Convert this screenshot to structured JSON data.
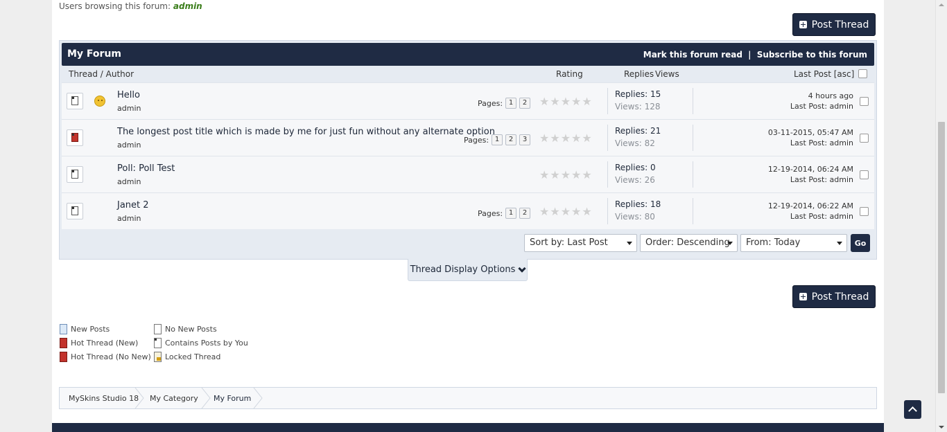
{
  "header": {
    "browsing_label": "Users browsing this forum:",
    "browsing_user": "admin"
  },
  "post_thread_label": "Post Thread",
  "forum": {
    "title": "My Forum",
    "mark_read": "Mark this forum read",
    "separator": "|",
    "subscribe": "Subscribe to this forum"
  },
  "columns": {
    "thread_author": "Thread / Author",
    "rating": "Rating",
    "replies": "Replies",
    "views": "Views",
    "last_post": "Last Post [asc]"
  },
  "threads": [
    {
      "title": "Hello",
      "author": "admin",
      "hot": false,
      "smiley": true,
      "pages_label": "Pages:",
      "pages": [
        "1",
        "2"
      ],
      "replies": "Replies: 15",
      "views": "Views: 128",
      "last_date": "4 hours ago",
      "last_by": "Last Post: admin"
    },
    {
      "title": "The longest post title which is made by me for just fun without any alternate option",
      "author": "admin",
      "hot": true,
      "smiley": false,
      "pages_label": "Pages:",
      "pages": [
        "1",
        "2",
        "3"
      ],
      "replies": "Replies: 21",
      "views": "Views: 82",
      "last_date": "03-11-2015, 05:47 AM",
      "last_by": "Last Post: admin"
    },
    {
      "title": "Poll: Poll Test",
      "author": "admin",
      "hot": false,
      "smiley": false,
      "pages_label": "",
      "pages": [],
      "replies": "Replies: 0",
      "views": "Views: 26",
      "last_date": "12-19-2014, 06:24 AM",
      "last_by": "Last Post: admin"
    },
    {
      "title": "Janet 2",
      "author": "admin",
      "hot": false,
      "smiley": false,
      "pages_label": "Pages:",
      "pages": [
        "1",
        "2"
      ],
      "replies": "Replies: 18",
      "views": "Views: 80",
      "last_date": "12-19-2014, 06:22 AM",
      "last_by": "Last Post: admin"
    }
  ],
  "sort": {
    "sort_by": "Sort by: Last Post",
    "order": "Order: Descending",
    "from": "From: Today",
    "go": "Go"
  },
  "display_options": "Thread Display Options",
  "legend": {
    "new_posts": "New Posts",
    "no_new_posts": "No New Posts",
    "hot_new": "Hot Thread (New)",
    "contains_yours": "Contains Posts by You",
    "hot_no_new": "Hot Thread (No New)",
    "locked": "Locked Thread"
  },
  "breadcrumb": [
    "MySkins Studio 18",
    "My Category",
    "My Forum"
  ],
  "colors": {
    "header_navy": "#1f2b44",
    "row_bg": "#f6f7f9",
    "accent_green": "#3a7d1a"
  }
}
